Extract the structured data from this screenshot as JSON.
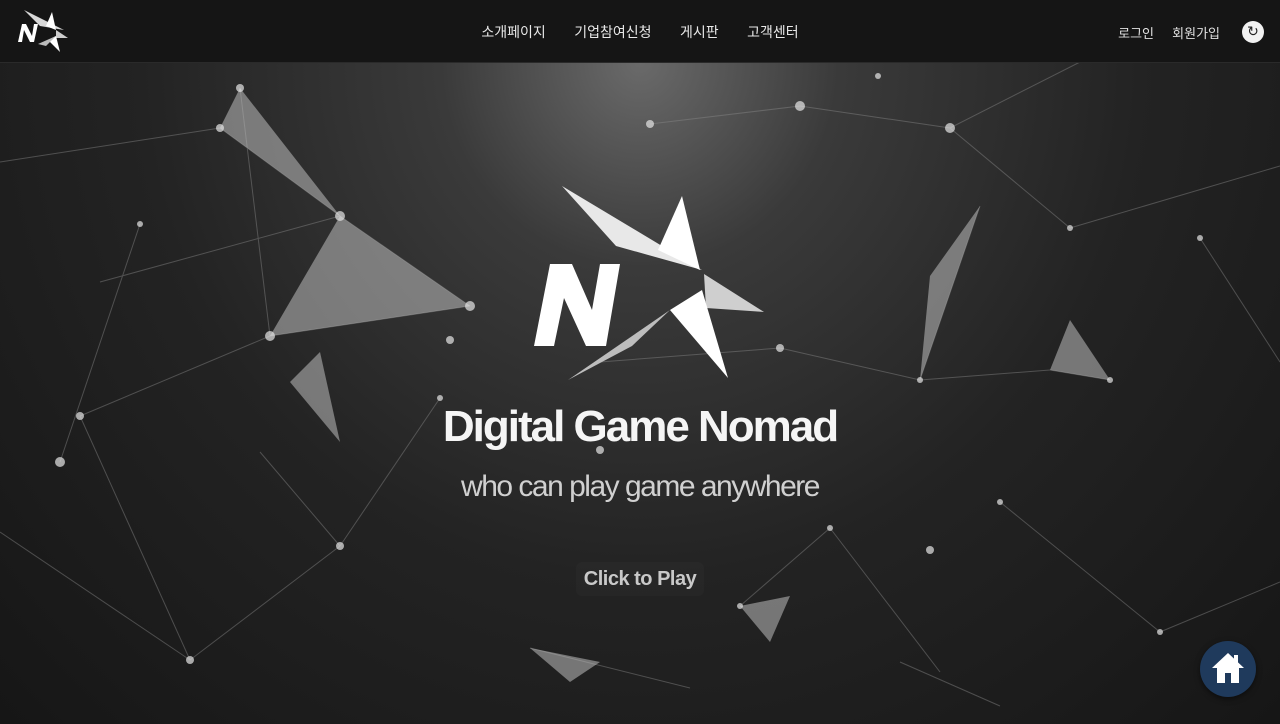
{
  "header": {
    "nav": [
      "소개페이지",
      "기업참여신청",
      "게시판",
      "고객센터"
    ],
    "login": "로그인",
    "signup": "회원가입",
    "refresh_icon": "↻"
  },
  "hero": {
    "title": "Digital Game Nomad",
    "subtitle": "who can play game anywhere",
    "cta": "Click to Play"
  },
  "colors": {
    "header_bg": "#151515",
    "home_button_bg": "#1f3a5c"
  }
}
